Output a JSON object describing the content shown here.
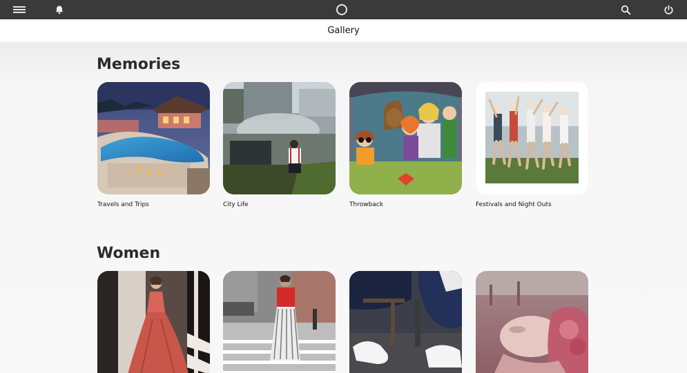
{
  "topbar": {
    "menu_icon": "hamburger-menu-icon",
    "bell_icon": "bell-icon",
    "home_icon": "circle-home-icon",
    "search_icon": "search-icon",
    "power_icon": "power-icon"
  },
  "header": {
    "title": "Gallery"
  },
  "sections": [
    {
      "title": "Memories",
      "albums": [
        {
          "label": "Travels and Trips"
        },
        {
          "label": "City Life"
        },
        {
          "label": "Throwback"
        },
        {
          "label": "Festivals and Night Outs"
        }
      ]
    },
    {
      "title": "Women",
      "albums": [
        {
          "label": ""
        },
        {
          "label": ""
        },
        {
          "label": ""
        },
        {
          "label": ""
        }
      ]
    }
  ],
  "colors": {
    "topbar_bg": "#3a3a3a",
    "title_bg": "#ffffff",
    "page_bg": "#f6f6f6"
  }
}
